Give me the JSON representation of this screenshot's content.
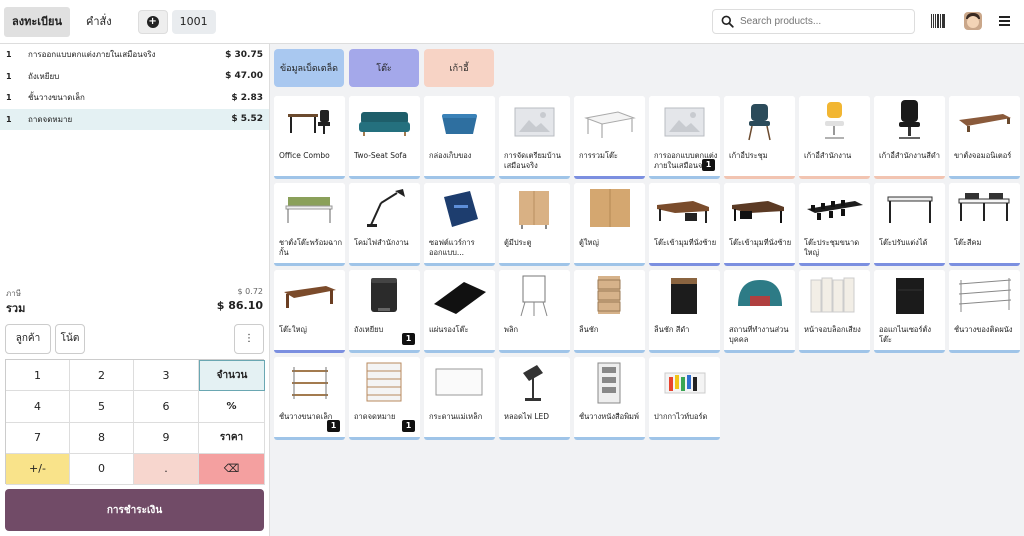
{
  "topbar": {
    "register_tab": "ลงทะเบียน",
    "orders_tab": "คำสั่ง",
    "add_order_symbol": "+",
    "order_number": "1001",
    "search_placeholder": "Search products..."
  },
  "order_lines": [
    {
      "qty": "1",
      "name": "การออกแบบตกแต่งภายในเสมือนจริง",
      "price": "$ 30.75"
    },
    {
      "qty": "1",
      "name": "ถังเหยียบ",
      "price": "$ 47.00"
    },
    {
      "qty": "1",
      "name": "ชั้นวางขนาดเล็ก",
      "price": "$ 2.83"
    },
    {
      "qty": "1",
      "name": "ถาดจดหมาย",
      "price": "$ 5.52"
    }
  ],
  "summary": {
    "tax_label": "ภาษี",
    "tax_value": "$ 0.72",
    "total_label": "รวม",
    "total_value": "$ 86.10"
  },
  "actions": {
    "customer": "ลูกค้า",
    "note": "โน้ต",
    "more": "⋮"
  },
  "numpad": {
    "k1": "1",
    "k2": "2",
    "k3": "3",
    "qty": "จำนวน",
    "k4": "4",
    "k5": "5",
    "k6": "6",
    "percent": "%",
    "k7": "7",
    "k8": "8",
    "k9": "9",
    "price": "ราคา",
    "plusminus": "+/-",
    "k0": "0",
    "dot": ".",
    "backspace": "⌫"
  },
  "payment_label": "การชำระเงิน",
  "categories": [
    {
      "label": "ข้อมูลเบ็ดเตล็ด",
      "color": "#a9c8f0"
    },
    {
      "label": "โต๊ะ",
      "color": "#a4a8ea"
    },
    {
      "label": "เก้าอี้",
      "color": "#f7d3c5"
    }
  ],
  "products": [
    {
      "name": "Office Combo",
      "badge": "",
      "strip": "#9fc4e8",
      "thumb": "desk-chair"
    },
    {
      "name": "Two-Seat Sofa",
      "badge": "",
      "strip": "#9fc4e8",
      "thumb": "sofa"
    },
    {
      "name": "กล่องเก็บของ",
      "badge": "",
      "strip": "#9fc4e8",
      "thumb": "basket"
    },
    {
      "name": "การจัดเตรียมบ้านเสมือนจริง",
      "badge": "",
      "strip": "#9fc4e8",
      "thumb": "placeholder"
    },
    {
      "name": "การรวมโต๊ะ",
      "badge": "",
      "strip": "#7b8fe0",
      "thumb": "table-white"
    },
    {
      "name": "การออกแบบตกแต่งภายในเสมือนจริง",
      "badge": "1",
      "strip": "#9fc4e8",
      "thumb": "placeholder"
    },
    {
      "name": "เก้าอี้ประชุม",
      "badge": "",
      "strip": "#f2c4b1",
      "thumb": "chair-teal"
    },
    {
      "name": "เก้าอี้สำนักงาน",
      "badge": "",
      "strip": "#f2c4b1",
      "thumb": "chair-yellow"
    },
    {
      "name": "เก้าอี้สำนักงานสีดำ",
      "badge": "",
      "strip": "#f2c4b1",
      "thumb": "chair-black"
    },
    {
      "name": "ขาตั้งจอมอนิเตอร์",
      "badge": "",
      "strip": "#9fc4e8",
      "thumb": "stand"
    },
    {
      "name": "ชาตั้งโต๊ะพร้อมฉากกั้น",
      "badge": "",
      "strip": "#9fc4e8",
      "thumb": "desk-screen"
    },
    {
      "name": "โคมไฟสำนักงาน",
      "badge": "",
      "strip": "#9fc4e8",
      "thumb": "lamp"
    },
    {
      "name": "ซอฟต์แวร์การออกแบบ...",
      "badge": "",
      "strip": "#9fc4e8",
      "thumb": "box"
    },
    {
      "name": "ตู้มีประตู",
      "badge": "",
      "strip": "#9fc4e8",
      "thumb": "cabinet"
    },
    {
      "name": "ตู้ใหญ่",
      "badge": "",
      "strip": "#9fc4e8",
      "thumb": "cabinet-big"
    },
    {
      "name": "โต๊ะเข้ามุมที่นั่งซ้าย",
      "badge": "",
      "strip": "#7b8fe0",
      "thumb": "corner-desk"
    },
    {
      "name": "โต๊ะเข้ามุมที่นั่งซ้าย",
      "badge": "",
      "strip": "#7b8fe0",
      "thumb": "corner-desk-dark"
    },
    {
      "name": "โต๊ะประชุมขนาดใหญ่",
      "badge": "",
      "strip": "#7b8fe0",
      "thumb": "conference"
    },
    {
      "name": "โต๊ะปรับแต่งได้",
      "badge": "",
      "strip": "#7b8fe0",
      "thumb": "table-black"
    },
    {
      "name": "โต๊ะสีคม",
      "badge": "",
      "strip": "#7b8fe0",
      "thumb": "four-desk"
    },
    {
      "name": "โต๊ะใหญ่",
      "badge": "",
      "strip": "#7b8fe0",
      "thumb": "big-desk"
    },
    {
      "name": "ถังเหยียบ",
      "badge": "1",
      "strip": "#9fc4e8",
      "thumb": "bin"
    },
    {
      "name": "แผ่นรองโต๊ะ",
      "badge": "",
      "strip": "#9fc4e8",
      "thumb": "mat"
    },
    {
      "name": "พลิก",
      "badge": "",
      "strip": "#9fc4e8",
      "thumb": "flipchart"
    },
    {
      "name": "ลิ้นชัก",
      "badge": "",
      "strip": "#9fc4e8",
      "thumb": "drawer"
    },
    {
      "name": "ลิ้นชัก สีดำ",
      "badge": "",
      "strip": "#9fc4e8",
      "thumb": "drawer-black"
    },
    {
      "name": "สถานที่ทำงานส่วนบุคคล",
      "badge": "",
      "strip": "#9fc4e8",
      "thumb": "booth"
    },
    {
      "name": "หน้าจอบล็อกเสียง",
      "badge": "",
      "strip": "#9fc4e8",
      "thumb": "screen"
    },
    {
      "name": "ออแกไนเซอร์ตั้งโต๊ะ",
      "badge": "",
      "strip": "#9fc4e8",
      "thumb": "organizer"
    },
    {
      "name": "ชั้นวางของติดผนัง",
      "badge": "",
      "strip": "#9fc4e8",
      "thumb": "wall-shelf"
    },
    {
      "name": "ชั้นวางขนาดเล็ก",
      "badge": "1",
      "strip": "#9fc4e8",
      "thumb": "small-shelf"
    },
    {
      "name": "ถาดจดหมาย",
      "badge": "1",
      "strip": "#9fc4e8",
      "thumb": "letter-tray"
    },
    {
      "name": "กระดานแม่เหล็ก",
      "badge": "",
      "strip": "#9fc4e8",
      "thumb": "whiteboard"
    },
    {
      "name": "หลอดไฟ LED",
      "badge": "",
      "strip": "#9fc4e8",
      "thumb": "led"
    },
    {
      "name": "ชั้นวางหนังสือพิมพ์",
      "badge": "",
      "strip": "#9fc4e8",
      "thumb": "newspaper"
    },
    {
      "name": "ปากกาไวท์บอร์ด",
      "badge": "",
      "strip": "#9fc4e8",
      "thumb": "markers"
    }
  ]
}
